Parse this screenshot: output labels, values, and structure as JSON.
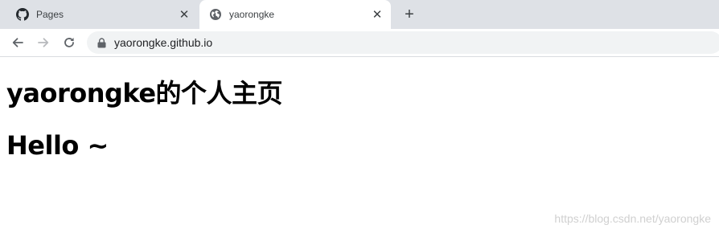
{
  "browser": {
    "tabs": [
      {
        "title": "Pages",
        "favicon": "github-icon",
        "active": false
      },
      {
        "title": "yaorongke",
        "favicon": "globe-icon",
        "active": true
      }
    ],
    "tab_close_glyph": "✕",
    "new_tab_glyph": "+",
    "address": "yaorongke.github.io"
  },
  "page": {
    "heading": "yaorongke的个人主页",
    "subheading": "Hello ~"
  },
  "watermark": "https://blog.csdn.net/yaorongke",
  "colors": {
    "tabstrip_bg": "#dee1e6",
    "omnibox_bg": "#f1f3f4",
    "text": "#000000",
    "watermark": "#d0d0d0"
  }
}
